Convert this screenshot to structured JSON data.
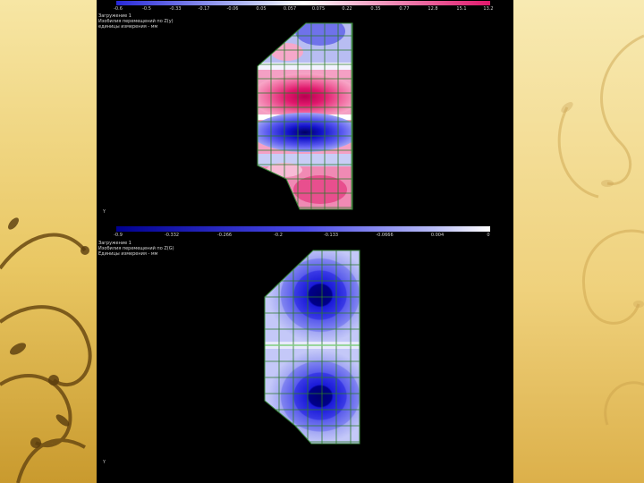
{
  "top_panel": {
    "info_lines": [
      "Загружение 1",
      "Изобилия перемещений по Z(y)",
      "единицы измерения - мм"
    ],
    "scale_ticks": [
      "-0.6",
      "-0.5",
      "-0.33",
      "-0.17",
      "-0.06",
      "0.05",
      "0.057",
      "0.075",
      "0.22",
      "0.35",
      "0.77",
      "12.8",
      "15.1",
      "13.2"
    ],
    "axis_label": "Y",
    "colors": {
      "low": "#2020d8",
      "mid": "#ffffff",
      "high": "#e0186c"
    }
  },
  "bottom_panel": {
    "info_lines": [
      "Загружение 1",
      "Изобилия перемещений по Z(G)",
      "Единицы измерения - мм"
    ],
    "scale_ticks": [
      "-0.9",
      "-0.332",
      "-0.266",
      "-0.2",
      "-0.133",
      "-0.0666",
      "0.004",
      "0"
    ],
    "axis_label": "Y",
    "colors": {
      "low": "#000090",
      "mid": "#4040e8",
      "high": "#ffffff"
    }
  },
  "decor": {
    "icon": "gold-swirl-ornament-icon"
  }
}
